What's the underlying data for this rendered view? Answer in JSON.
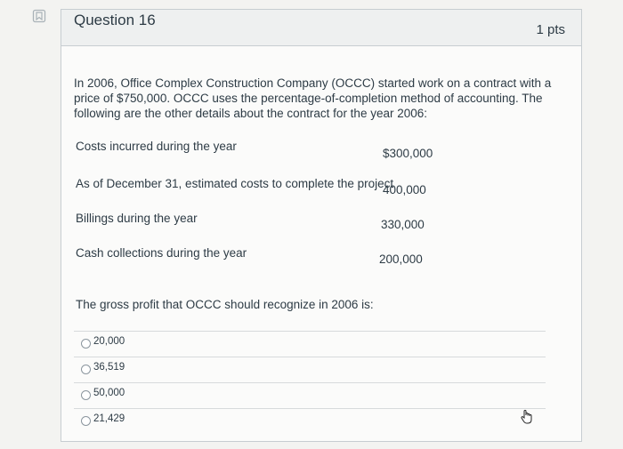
{
  "question": {
    "title": "Question 16",
    "points": "1 pts",
    "intro": "In 2006, Office Complex Construction Company (OCCC) started work on a contract with a price of $750,000. OCCC uses the percentage-of-completion method of accounting. The following are the other details about the contract for the year 2006:",
    "details": [
      {
        "label": "Costs incurred during the year",
        "value": "$300,000"
      },
      {
        "label": "As of December 31, estimated costs to complete the project",
        "value": "400,000"
      },
      {
        "label": "Billings during the year",
        "value": "330,000"
      },
      {
        "label": "Cash collections during the year",
        "value": "200,000"
      }
    ],
    "prompt": "The gross profit that OCCC should recognize in 2006 is:",
    "answers": [
      "20,000",
      "36,519",
      "50,000",
      "21,429"
    ]
  },
  "icons": {
    "flag": "bookmark-flag-icon",
    "cursor": "hand-pointer-icon"
  },
  "colors": {
    "text": "#2d3b45",
    "border": "#c7cdd1",
    "header_bg": "#eef0f0"
  }
}
